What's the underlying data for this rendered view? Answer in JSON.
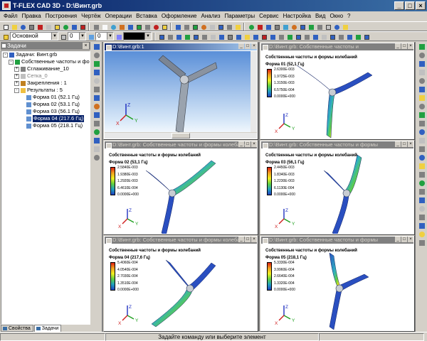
{
  "window": {
    "title": "T-FLEX CAD 3D - D:\\Винт.grb",
    "minimize_glyph": "_",
    "maximize_glyph": "□",
    "close_glyph": "×"
  },
  "menu": [
    "Файл",
    "Правка",
    "Построения",
    "Чертёж",
    "Операции",
    "Вставка",
    "Оформление",
    "Анализ",
    "Параметры",
    "Сервис",
    "Настройка",
    "Вид",
    "Окно",
    "?"
  ],
  "toolbar2": {
    "layer_combo": "Основной",
    "field_a": "0",
    "field_b": "0"
  },
  "tasks_panel": {
    "title": "Задачи",
    "close_glyph": "×",
    "tree": [
      {
        "label": "Задачи: Винт.grb",
        "indent": 0,
        "expander": "-",
        "icon_color": "#3060c0"
      },
      {
        "label": "Собственные частоты и формы ко",
        "indent": 1,
        "expander": "-",
        "icon_color": "#20a040"
      },
      {
        "label": "Сглаживание_10",
        "indent": 2,
        "expander": "+",
        "icon_color": "#808080"
      },
      {
        "label": "Сетка_0",
        "indent": 2,
        "expander": "+",
        "icon_color": "#c0c0c0",
        "muted": true
      },
      {
        "label": "Закрепления : 1",
        "indent": 2,
        "expander": "+",
        "icon_color": "#c08020"
      },
      {
        "label": "Результаты : 5",
        "indent": 2,
        "expander": "-",
        "icon_color": "#f0c040"
      },
      {
        "label": "Форма 01 (52.1 Гц)",
        "indent": 3,
        "expander": "",
        "icon_color": "#6090d0"
      },
      {
        "label": "Форма 02 (53.1 Гц)",
        "indent": 3,
        "expander": "",
        "icon_color": "#6090d0"
      },
      {
        "label": "Форма 03 (56.1 Гц)",
        "indent": 3,
        "expander": "",
        "icon_color": "#6090d0"
      },
      {
        "label": "Форма 04 (217.6 Гц)",
        "indent": 3,
        "expander": "",
        "icon_color": "#6090d0",
        "selected": true
      },
      {
        "label": "Форма 05 (218.1 Гц)",
        "indent": 3,
        "expander": "",
        "icon_color": "#6090d0"
      }
    ],
    "tabs": [
      "Свойства",
      "Задачи"
    ]
  },
  "windows": {
    "model": {
      "title": "D:\\Винт.grb:1"
    },
    "r1": {
      "title": "D:\\Винт.grb: Собственные частоты и",
      "study": "Собственные частоты и формы колебаний",
      "mode": "Форма 01 (52,1 Гц)",
      "legend": [
        "2.6300E-003",
        "1.9725E-003",
        "1.3150E-003",
        "6.5750E-004",
        "0.0000E+000"
      ]
    },
    "r2": {
      "title": "D:\\Винт.grb: Собственные частоты и формы колебаний",
      "study": "Собственные частоты и формы колебаний",
      "mode": "Форма 02 (53,1 Гц)",
      "legend": [
        "2.5840E-003",
        "1.9380E-003",
        "1.2920E-003",
        "6.4610E-004",
        "0.0000E+000"
      ]
    },
    "r3": {
      "title": "D:\\Винт.grb: Собственные частоты и формы",
      "study": "Собственные частоты и формы колебаний",
      "mode": "Форма 03 (56,1 Гц)",
      "legend": [
        "2.4450E-003",
        "1.8340E-003",
        "1.2230E-003",
        "6.1130E-004",
        "0.0000E+000"
      ]
    },
    "r4": {
      "title": "D:\\Винт.grb: Собственные частоты и формы колебаний",
      "study": "Собственные частоты и формы колебаний",
      "mode": "Форма 04 (217,6 Гц)",
      "legend": [
        "5.4060E-004",
        "4.0540E-004",
        "2.7030E-004",
        "1.3510E-004",
        "0.0000E+000"
      ]
    },
    "r5": {
      "title": "D:\\Винт.grb: Собственные частоты и формы",
      "study": "Собственные частоты и формы колебаний",
      "mode": "Форма 05 (218,1 Гц)",
      "legend": [
        "5.3330E-004",
        "3.9960E-004",
        "2.6640E-004",
        "1.3320E-004",
        "0.0000E+000"
      ]
    }
  },
  "axes": {
    "x": "X",
    "y": "Y",
    "z": "Z"
  },
  "status": "Задайте команду или выберите элемент"
}
